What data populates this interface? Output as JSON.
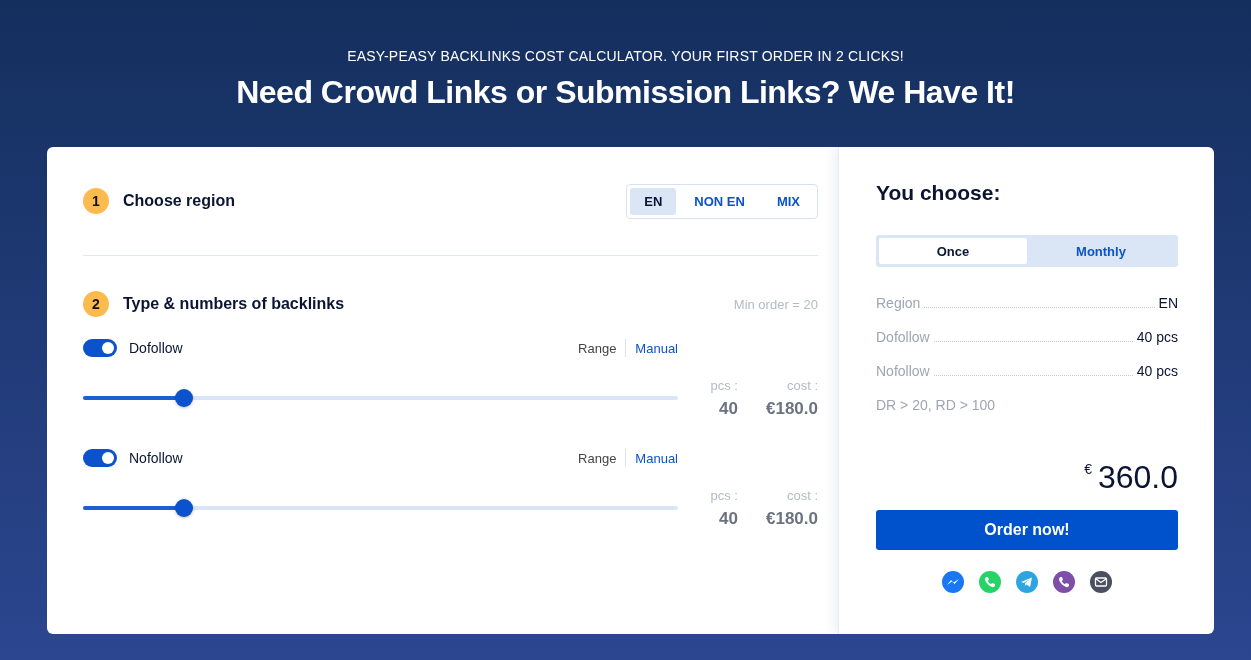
{
  "header": {
    "subtitle": "EASY-PEASY BACKLINKS COST CALCULATOR. YOUR FIRST ORDER IN 2 CLICKS!",
    "title": "Need Crowd Links or Submission Links? We Have It!"
  },
  "step1": {
    "number": "1",
    "title": "Choose region",
    "regions": [
      {
        "label": "EN",
        "selected": true
      },
      {
        "label": "NON EN",
        "selected": false
      },
      {
        "label": "MIX",
        "selected": false
      }
    ]
  },
  "step2": {
    "number": "2",
    "title": "Type & numbers of backlinks",
    "note": "Min order = 20",
    "links": [
      {
        "name": "Dofollow",
        "on": true,
        "modes": [
          {
            "label": "Range",
            "selected": true
          },
          {
            "label": "Manual",
            "selected": false
          }
        ],
        "level": 0.17,
        "pcs_label": "pcs :",
        "pcs": "40",
        "cost_label": "cost :",
        "cost": "€180.0"
      },
      {
        "name": "Nofollow",
        "on": true,
        "modes": [
          {
            "label": "Range",
            "selected": true
          },
          {
            "label": "Manual",
            "selected": false
          }
        ],
        "level": 0.17,
        "pcs_label": "pcs :",
        "pcs": "40",
        "cost_label": "cost :",
        "cost": "€180.0"
      }
    ]
  },
  "summary": {
    "title": "You choose:",
    "billing": [
      {
        "label": "Once",
        "selected": true
      },
      {
        "label": "Monthly",
        "selected": false
      }
    ],
    "rows": [
      {
        "label": "Region",
        "value": "EN"
      },
      {
        "label": "Dofollow",
        "value": "40 pcs"
      },
      {
        "label": "Nofollow",
        "value": "40 pcs"
      }
    ],
    "note": "DR > 20, RD > 100",
    "currency": "€",
    "total": "360.0",
    "button": "Order now!",
    "contacts": [
      {
        "kind": "messenger"
      },
      {
        "kind": "whatsapp"
      },
      {
        "kind": "telegram"
      },
      {
        "kind": "viber"
      },
      {
        "kind": "email"
      }
    ]
  }
}
